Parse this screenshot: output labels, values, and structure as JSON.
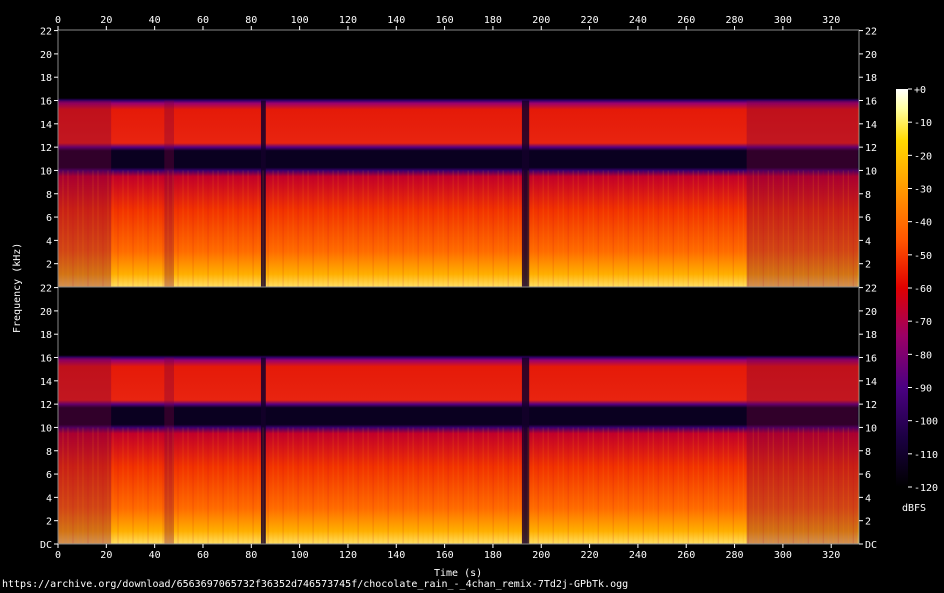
{
  "chart_data": {
    "type": "heatmap",
    "xlabel": "Time (s)",
    "ylabel": "Frequency (kHz)",
    "xlim": [
      0,
      331.5
    ],
    "ylim_khz": [
      0,
      22.05
    ],
    "x_ticks": [
      0,
      20,
      40,
      60,
      80,
      100,
      120,
      140,
      160,
      180,
      200,
      220,
      240,
      260,
      280,
      300,
      320
    ],
    "y_tick_labels_top": [
      "2",
      "4",
      "6",
      "8",
      "10",
      "12",
      "14",
      "16",
      "18",
      "20",
      "22"
    ],
    "y_tick_labels_bottom": [
      "DC",
      "2",
      "4",
      "6",
      "8",
      "10",
      "12",
      "14",
      "16",
      "18",
      "20",
      "22"
    ],
    "y_tick_values_top": [
      2,
      4,
      6,
      8,
      10,
      12,
      14,
      16,
      18,
      20,
      22
    ],
    "y_tick_values_bottom": [
      0,
      2,
      4,
      6,
      8,
      10,
      12,
      14,
      16,
      18,
      20,
      22
    ],
    "channels": 2,
    "colorbar": {
      "label": "dBFS",
      "ticks": [
        "+0",
        "-10",
        "-20",
        "-30",
        "-40",
        "-50",
        "-60",
        "-70",
        "-80",
        "-90",
        "-100",
        "-110",
        "-120"
      ],
      "tick_values": [
        0,
        -10,
        -20,
        -30,
        -40,
        -50,
        -60,
        -70,
        -80,
        -90,
        -100,
        -110,
        -120
      ],
      "range": [
        -120,
        0
      ]
    },
    "bands_khz": {
      "main_content_top": 10,
      "notch_low": 10,
      "notch_high": 12,
      "upper_band_top": 16,
      "silence_above": 16
    },
    "quiet_segments_s": [
      [
        84,
        86
      ],
      [
        192,
        195
      ]
    ],
    "sparse_segments_s": [
      [
        0,
        22
      ],
      [
        44,
        48
      ],
      [
        285,
        331
      ]
    ]
  },
  "footer": {
    "source_url": "https://archive.org/download/6563697065732f36352d746573745f/chocolate_rain_-_4chan_remix-7Td2j-GPbTk.ogg"
  },
  "colors": {
    "background": "#000000",
    "axis": "#ffffff",
    "colormap": [
      "#000000",
      "#1a0040",
      "#4b0082",
      "#9b0066",
      "#e00000",
      "#ff5500",
      "#ff9a00",
      "#ffd800",
      "#ffffa0",
      "#ffffff"
    ]
  }
}
